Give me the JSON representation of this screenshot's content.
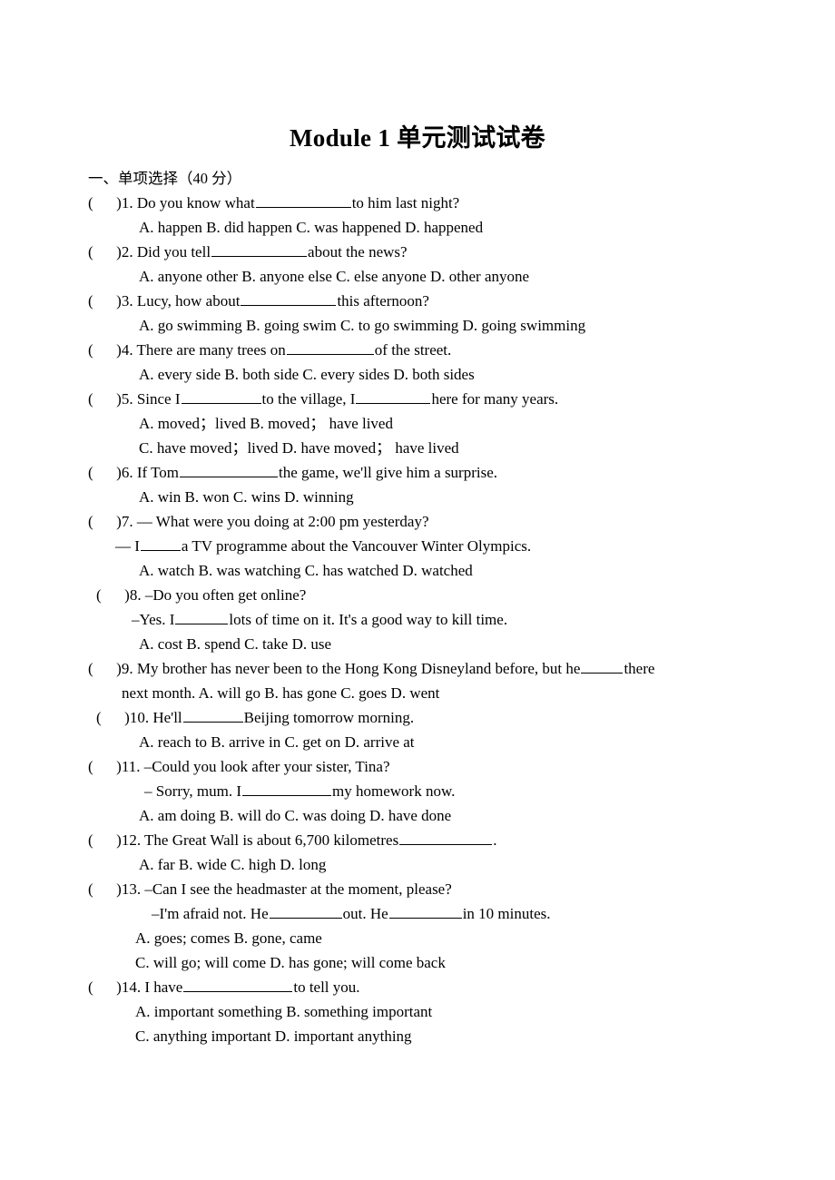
{
  "document": {
    "title": "Module 1 单元测试试卷",
    "section_heading": "一、单项选择（40 分）"
  },
  "questions": [
    {
      "num": "1",
      "bracket": "(      )",
      "stem_before": "1. Do you know what",
      "stem_after": "to him last night?",
      "blank_width": 105,
      "option_lines": [
        "A. happen      B. did happen     C. was happened     D. happened"
      ]
    },
    {
      "num": "2",
      "bracket": "(      )",
      "stem_before": "2. Did you tell",
      "stem_after": "about the news?",
      "blank_width": 105,
      "option_lines": [
        "A. anyone other     B. anyone else      C. else anyone     D. other anyone"
      ]
    },
    {
      "num": "3",
      "bracket": "(      )",
      "stem_before": "3. Lucy, how about",
      "stem_after": "this afternoon?",
      "blank_width": 105,
      "option_lines": [
        "A. go swimming     B. going swim      C. to go swimming    D. going swimming"
      ]
    },
    {
      "num": "4",
      "bracket": "(      )",
      "stem_before": "4. There are many trees on",
      "stem_after": "of the street.",
      "blank_width": 96,
      "option_lines": [
        "A. every side     B. both side     C. every sides      D. both sides"
      ]
    },
    {
      "num": "5",
      "bracket": "(      )",
      "stem_parts": [
        "5. Since I",
        "to the village, I",
        "here for many years."
      ],
      "blank_widths": [
        88,
        82
      ],
      "option_lines": [
        "A. moved；lived                B. moved；   have lived",
        "C. have moved；lived        D. have moved；   have lived"
      ]
    },
    {
      "num": "6",
      "bracket": "(      )",
      "stem_before": "6. If Tom",
      "stem_after": "the game, we'll give him a surprise.",
      "blank_width": 108,
      "option_lines": [
        "A. win      B. won      C. wins      D. winning"
      ]
    },
    {
      "num": "7",
      "bracket": "(      )",
      "stem_line": "7. — What were you doing at 2:00 pm yesterday?",
      "continuation_before": "— I",
      "continuation_after": "a TV programme about the Vancouver Winter Olympics.",
      "blank_width": 44,
      "option_lines": [
        "A. watch       B. was watching     C. has watched     D. watched"
      ]
    },
    {
      "num": "8",
      "bracket": "(      )",
      "indent": true,
      "stem_line": "8. –Do you often get online?",
      "continuation_before": "–Yes. I",
      "continuation_after": "lots of time on it. It's a good way to kill time.",
      "blank_width": 58,
      "option_lines": [
        "A. cost       B. spend         C. take       D. use"
      ]
    },
    {
      "num": "9",
      "bracket": "(      )",
      "stem_before": "9. My brother has never been to the Hong Kong Disneyland before, but he",
      "stem_after": "there",
      "blank_width": 46,
      "option_lines": [
        "next month.        A. will go       B. has gone C. goes      D. went"
      ],
      "options_inline": true
    },
    {
      "num": "10",
      "bracket": "(      )",
      "indent": true,
      "stem_before": "10. He'll",
      "stem_after": "Beijing tomorrow morning.",
      "blank_width": 66,
      "option_lines": [
        "A. reach to    B. arrive in        C. get on       D. arrive at"
      ]
    },
    {
      "num": "11",
      "bracket": "(      )",
      "stem_line": "11. –Could you look after your sister, Tina?",
      "continuation_before": "– Sorry, mum. I",
      "continuation_after": "my homework now.",
      "blank_width": 98,
      "option_lines": [
        "A. am doing      B. will do        C. was doing    D. have done"
      ]
    },
    {
      "num": "12",
      "bracket": "(      )",
      "stem_before": "12. The Great Wall is about 6,700 kilometres",
      "stem_after": ".",
      "blank_width": 102,
      "option_lines": [
        "A. far           B. wide        C. high      D. long"
      ]
    },
    {
      "num": "13",
      "bracket": "(      )",
      "stem_line": "13. –Can I see the headmaster at the moment, please?",
      "continuation_parts": [
        "–I'm afraid not. He",
        "out. He",
        "in 10 minutes."
      ],
      "blank_widths": [
        80,
        80
      ],
      "option_lines": [
        "A. goes; comes                B. gone, came",
        "C. will go; will come            D. has gone; will come back"
      ]
    },
    {
      "num": "14",
      "bracket": "(      )",
      "stem_before": "14. I have",
      "stem_after": "to tell you.",
      "blank_width": 120,
      "option_lines": [
        "A. important something    B. something important",
        "C. anything important     D. important anything"
      ]
    }
  ]
}
